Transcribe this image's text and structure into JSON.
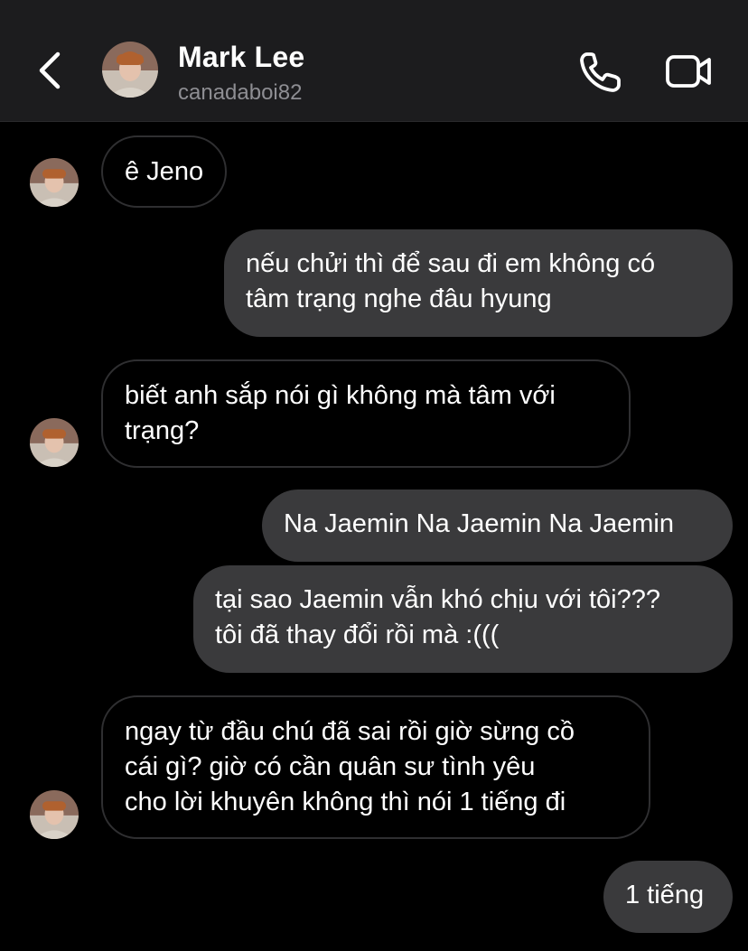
{
  "header": {
    "contact_name": "Mark Lee",
    "contact_handle": "canadaboi82",
    "back_icon": "chevron-left-icon",
    "call_icon": "phone-icon",
    "video_icon": "video-camera-icon"
  },
  "colors": {
    "background": "#000000",
    "header_background": "#1c1c1e",
    "outgoing_bubble": "#3a3a3c",
    "incoming_bubble_border": "#2f2f31",
    "secondary_text": "#8e8e93",
    "text": "#ffffff"
  },
  "messages": [
    {
      "direction": "incoming",
      "lines": [
        "ê Jeno"
      ]
    },
    {
      "direction": "outgoing",
      "lines": [
        "nếu chửi thì để sau đi em không có",
        "tâm trạng nghe đâu hyung"
      ]
    },
    {
      "direction": "incoming",
      "lines": [
        "biết anh sắp nói gì không mà tâm với",
        "trạng?"
      ]
    },
    {
      "direction": "outgoing",
      "lines": [
        "Na Jaemin Na Jaemin Na Jaemin"
      ]
    },
    {
      "direction": "outgoing",
      "lines": [
        "tại sao Jaemin vẫn khó chịu với tôi???",
        "tôi đã thay đổi rồi mà :((("
      ]
    },
    {
      "direction": "incoming",
      "lines": [
        "ngay từ đầu chú đã sai rồi giờ sừng cồ",
        "cái gì? giờ có cần quân sư tình yêu",
        "cho lời khuyên không thì nói 1 tiếng đi"
      ]
    },
    {
      "direction": "outgoing",
      "lines": [
        "1 tiếng"
      ]
    }
  ]
}
